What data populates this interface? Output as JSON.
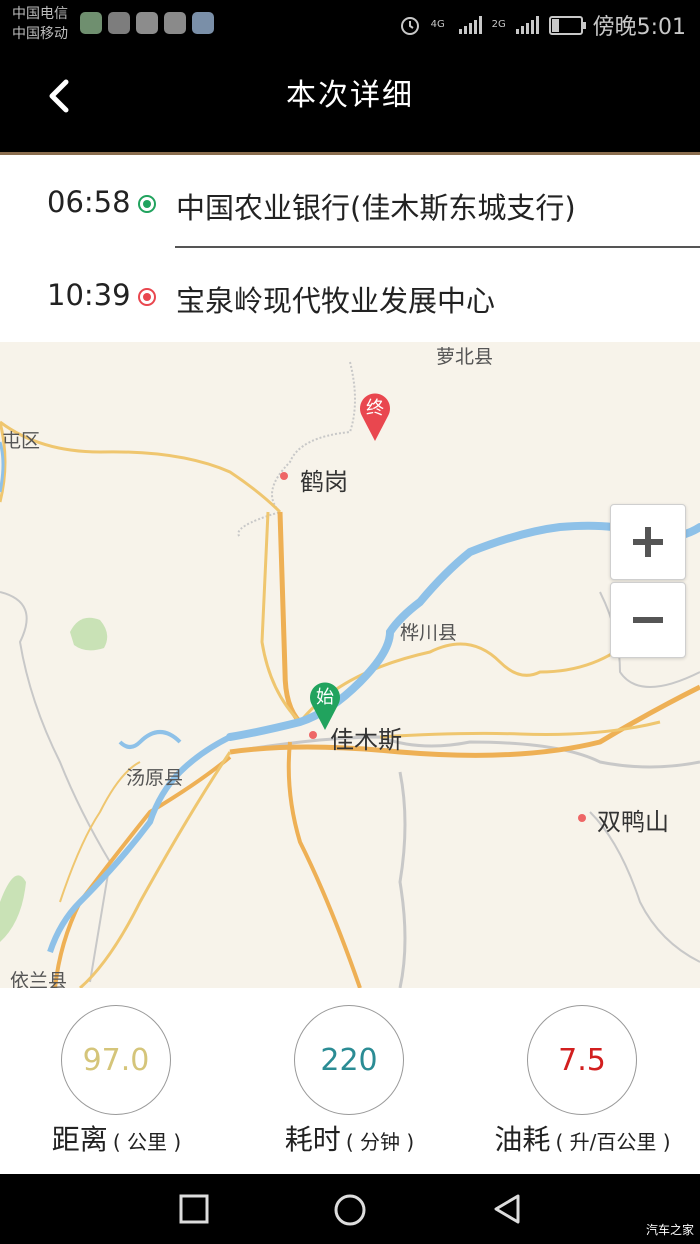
{
  "status_bar": {
    "carrier_1": "中国电信",
    "carrier_2": "中国移动",
    "network_label_1": "4G",
    "network_label_2": "2G",
    "time": "傍晚5:01",
    "icons": [
      "alarm-icon",
      "signal-icon",
      "battery-icon"
    ]
  },
  "header": {
    "title": "本次详细",
    "back_icon": "chevron-left-icon"
  },
  "route": {
    "start": {
      "time": "06:58",
      "place": "中国农业银行(佳木斯东城支行)",
      "color": "#21a35e"
    },
    "end": {
      "time": "10:39",
      "place": "宝泉岭现代牧业发展中心",
      "color": "#e9474f"
    }
  },
  "map": {
    "labels": {
      "luobei": "萝北县",
      "tunqu": "屯区",
      "hegang": "鹤岗",
      "huachuan": "桦川县",
      "jiamusi": "佳木斯",
      "tangyuan": "汤原县",
      "shuangyashan": "双鸭山",
      "yilan": "依兰县"
    },
    "start_marker": "始",
    "end_marker": "终",
    "zoom_in_icon": "plus-icon",
    "zoom_out_icon": "minus-icon"
  },
  "stats": [
    {
      "value": "97.0",
      "label": "距离",
      "unit": "( 公里 )",
      "color": "#d5c57a"
    },
    {
      "value": "220",
      "label": "耗时",
      "unit": "( 分钟 )",
      "color": "#2b8c94"
    },
    {
      "value": "7.5",
      "label": "油耗",
      "unit": "( 升/百公里 )",
      "color": "#d21f1f"
    }
  ],
  "nav_bar": {
    "icons": [
      "recent-apps-icon",
      "home-icon",
      "back-icon"
    ]
  },
  "watermark": "汽车之家"
}
